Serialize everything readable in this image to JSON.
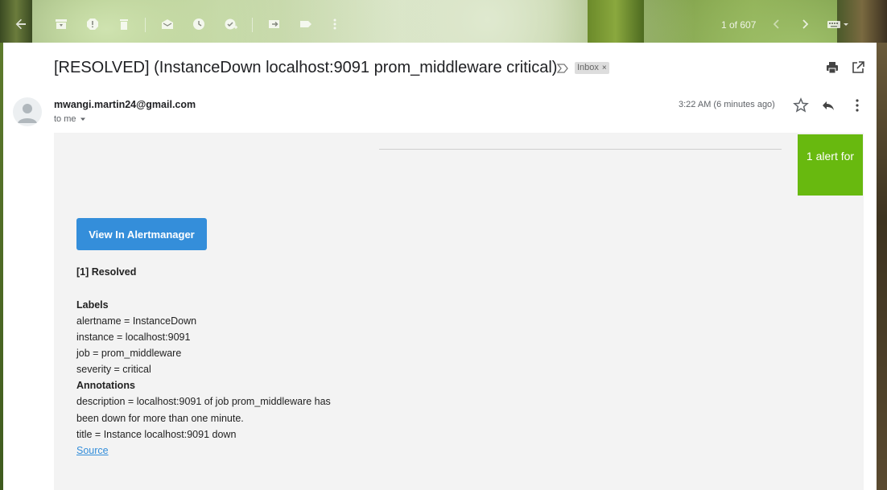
{
  "toolbar": {
    "page_count": "1 of 607",
    "icons": [
      "back-arrow-icon",
      "archive-icon",
      "report-spam-icon",
      "delete-icon",
      "mark-unread-icon",
      "snooze-icon",
      "add-task-icon",
      "move-to-icon",
      "label-icon",
      "more-vert-icon",
      "newer-icon",
      "older-icon",
      "keyboard-icon"
    ]
  },
  "email": {
    "subject": "[RESOLVED] (InstanceDown localhost:9091 prom_middleware critical)",
    "label_chip": "Inbox",
    "label_chip_close": "×",
    "sender": "mwangi.martin24@gmail.com",
    "recipient": "to me",
    "timestamp": "3:22 AM (6 minutes ago)"
  },
  "message": {
    "alert_box": "1 alert for",
    "view_button": "View In Alertmanager",
    "status_heading": "[1] Resolved",
    "labels_heading": "Labels",
    "labels": [
      "alertname = InstanceDown",
      "instance = localhost:9091",
      "job = prom_middleware",
      "severity = critical"
    ],
    "annotations_heading": "Annotations",
    "annotations": [
      "description = localhost:9091 of job prom_middleware has been down for more than one minute.",
      "title = Instance localhost:9091 down"
    ],
    "source_link": "Source"
  },
  "colors": {
    "alert_green": "#68b90f",
    "button_blue": "#348eda",
    "body_gray": "#f3f3f3"
  }
}
